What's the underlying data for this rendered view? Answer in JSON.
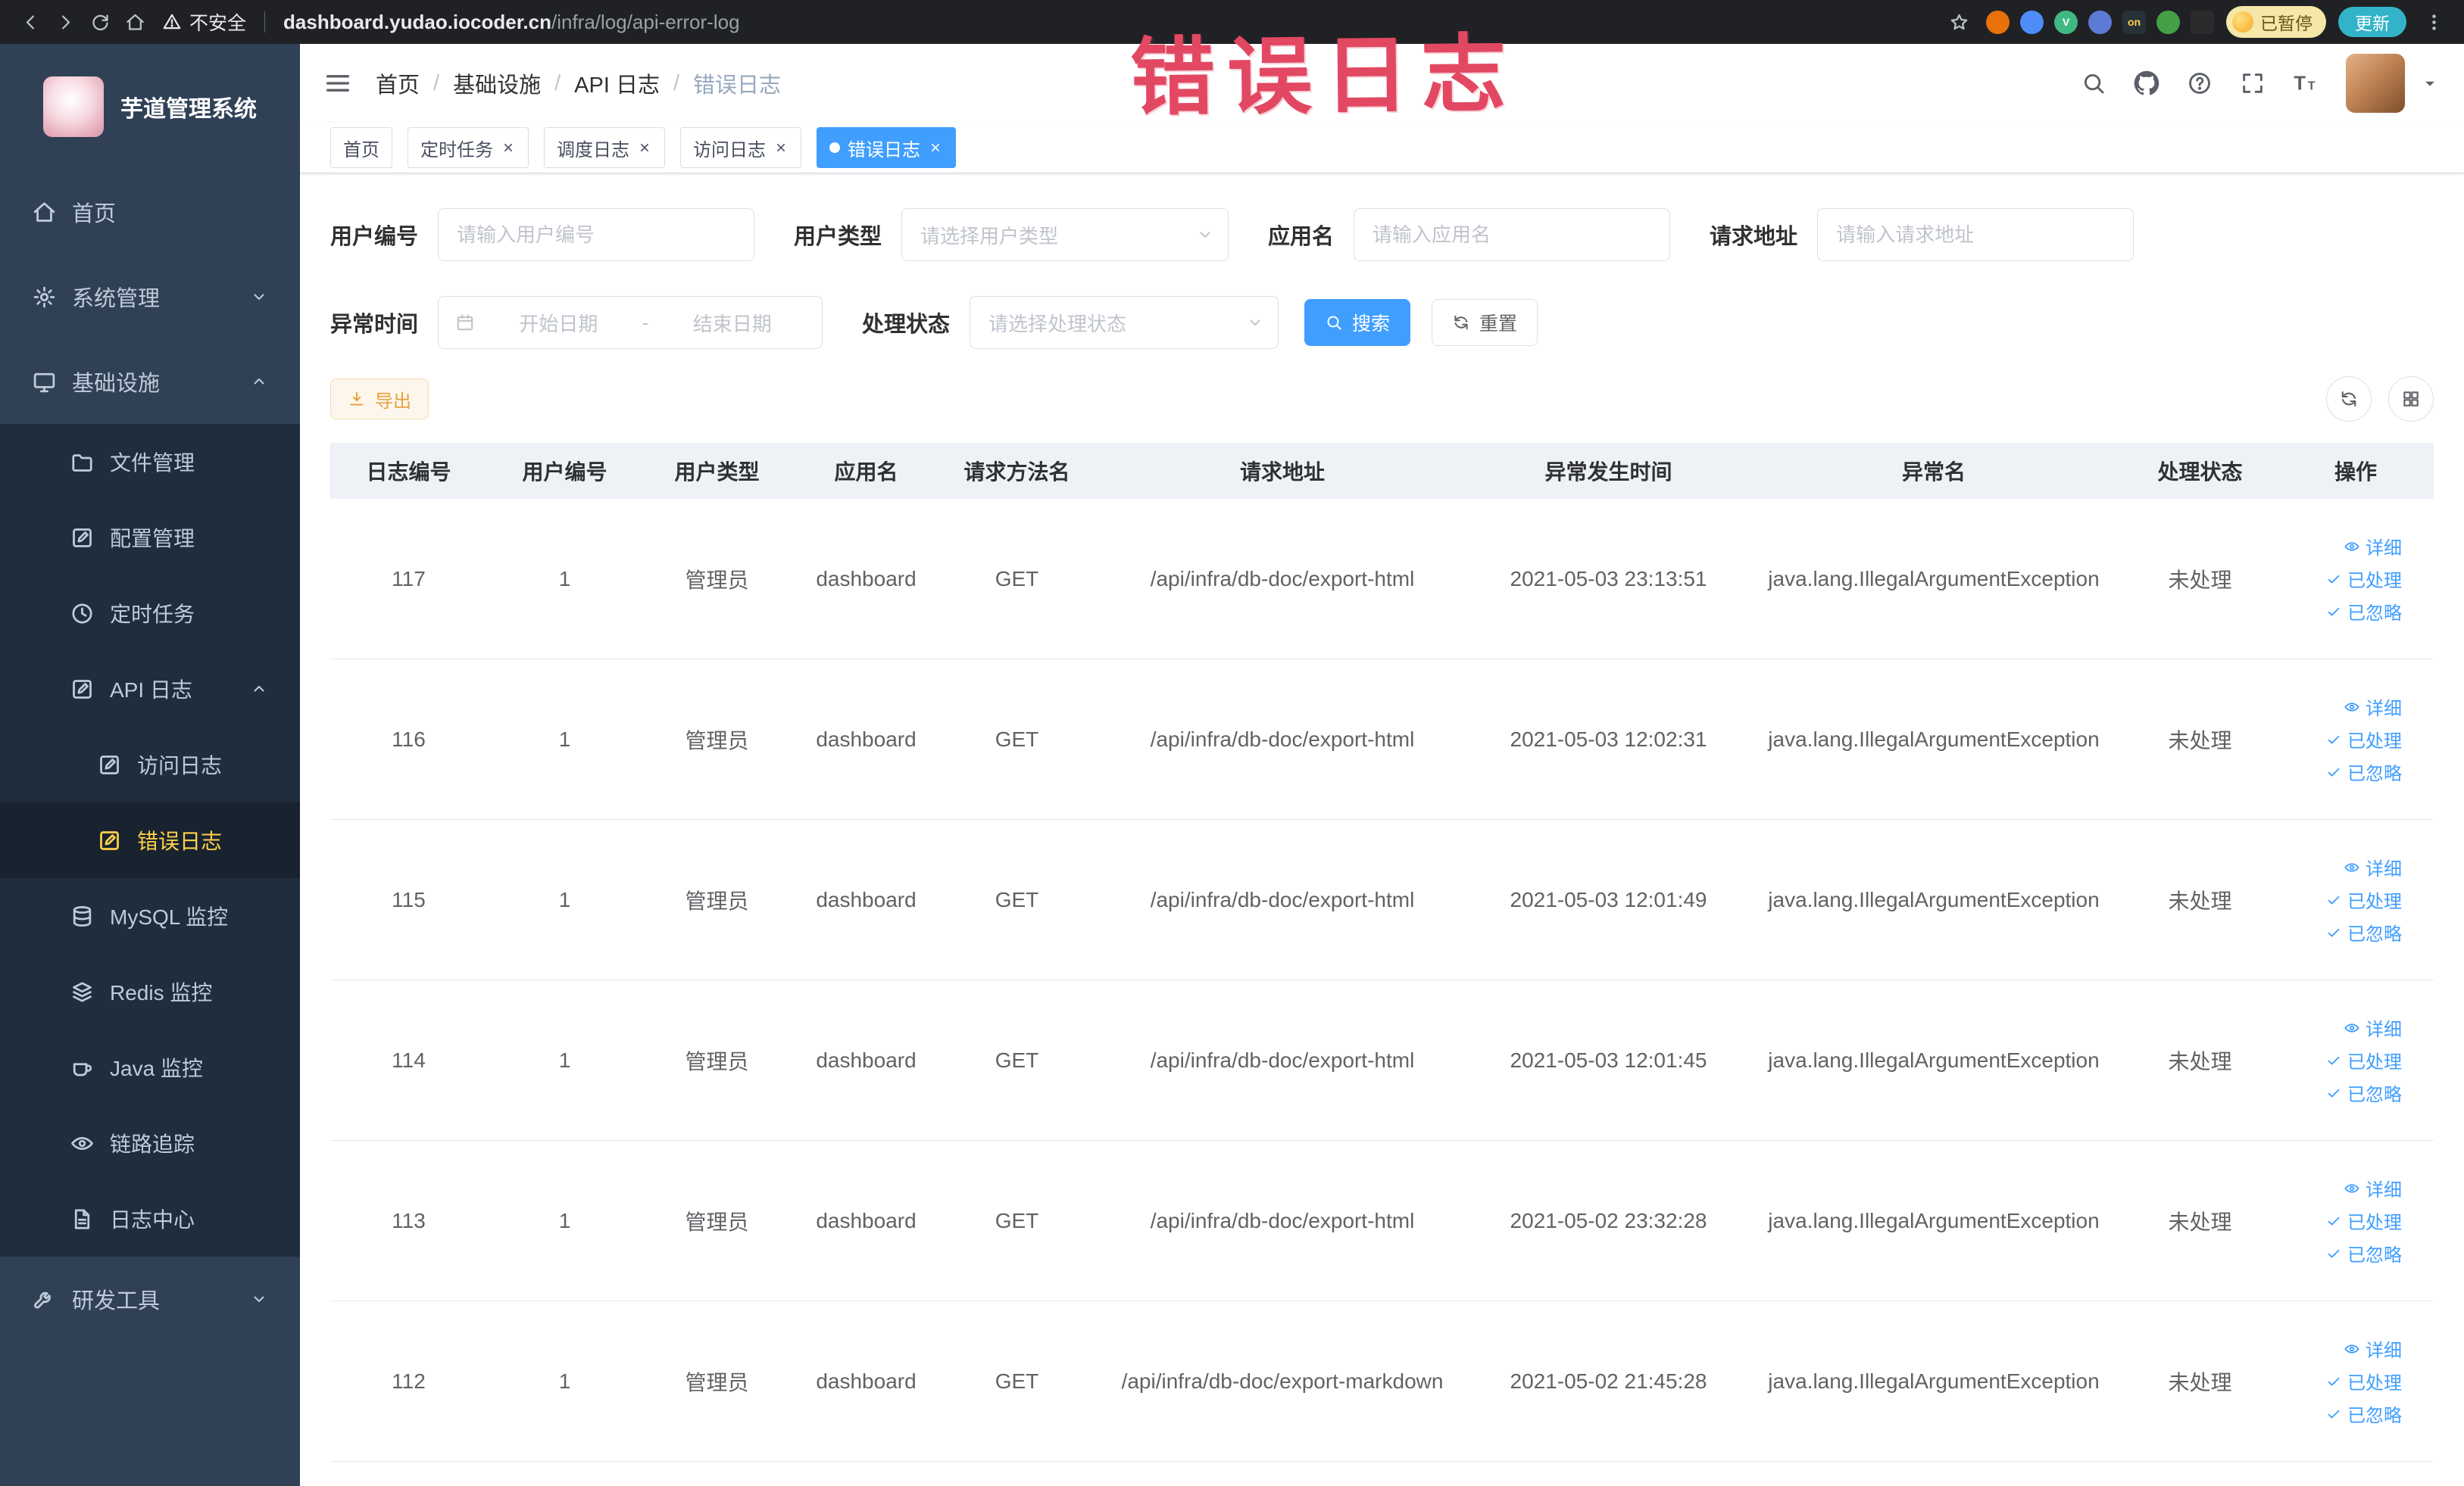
{
  "colors": {
    "primary": "#409eff",
    "menu-active": "#ffd04b",
    "sidebar-bg": "#304156",
    "submenu-bg": "#1f2d3d",
    "menu-text": "#bfcbd9",
    "warning": "#e6a23c",
    "warning-bg": "#fdf6ec",
    "warning-border": "#f5dab1",
    "annotation": "#e24862",
    "chrome-bg": "#202124",
    "update-pill": "#33b3c8",
    "paused-bg": "#f5e7a8"
  },
  "browser": {
    "security_label": "不安全",
    "url_host": "dashboard.yudao.iocoder.cn",
    "url_path": "/infra/log/api-error-log",
    "paused_badge": "已暂停",
    "update_button": "更新",
    "extensions": [
      {
        "name": "extension-orange-icon",
        "color": "#e8710a",
        "text": ""
      },
      {
        "name": "extension-blue-icon",
        "color": "#4e8cf9",
        "text": ""
      },
      {
        "name": "vue-devtools-icon",
        "color": "#41b883",
        "text": "V"
      },
      {
        "name": "extension-grid-icon",
        "color": "#5b7bd5",
        "text": ""
      },
      {
        "name": "proxy-switch-icon",
        "color": "#263238",
        "text": "on"
      },
      {
        "name": "extension-green-icon",
        "color": "#43a047",
        "text": ""
      },
      {
        "name": "tampermonkey-icon",
        "color": "#2b2b2b",
        "text": ""
      }
    ]
  },
  "annotation": {
    "text": "错误日志"
  },
  "sidebar": {
    "logo_title": "芋道管理系统",
    "items": [
      {
        "id": "home",
        "label": "首页",
        "icon": "home",
        "level": 0
      },
      {
        "id": "system",
        "label": "系统管理",
        "icon": "gear",
        "level": 0,
        "arrow": "down"
      },
      {
        "id": "infra",
        "label": "基础设施",
        "icon": "monitor",
        "level": 0,
        "arrow": "up"
      },
      {
        "id": "file",
        "label": "文件管理",
        "icon": "folder",
        "level": 1
      },
      {
        "id": "config",
        "label": "配置管理",
        "icon": "pencil-square",
        "level": 1
      },
      {
        "id": "job",
        "label": "定时任务",
        "icon": "clock",
        "level": 1
      },
      {
        "id": "api-log",
        "label": "API 日志",
        "icon": "pencil-square",
        "level": 1,
        "arrow": "up"
      },
      {
        "id": "access-log",
        "label": "访问日志",
        "icon": "pencil-square",
        "level": 2
      },
      {
        "id": "error-log",
        "label": "错误日志",
        "icon": "pencil-square",
        "level": 2,
        "active": true
      },
      {
        "id": "mysql",
        "label": "MySQL 监控",
        "icon": "database",
        "level": 1
      },
      {
        "id": "redis",
        "label": "Redis 监控",
        "icon": "layers",
        "level": 1
      },
      {
        "id": "java",
        "label": "Java 监控",
        "icon": "coffee",
        "level": 1
      },
      {
        "id": "trace",
        "label": "链路追踪",
        "icon": "eye",
        "level": 1
      },
      {
        "id": "log-center",
        "label": "日志中心",
        "icon": "doc",
        "level": 1
      },
      {
        "id": "dev-tools",
        "label": "研发工具",
        "icon": "wrench",
        "level": 0,
        "arrow": "down"
      }
    ]
  },
  "header": {
    "breadcrumb": [
      "首页",
      "基础设施",
      "API 日志",
      "错误日志"
    ],
    "actions": [
      "search",
      "github",
      "question",
      "fullscreen",
      "font-size"
    ]
  },
  "tabs": [
    {
      "label": "首页",
      "closable": false,
      "active": false
    },
    {
      "label": "定时任务",
      "closable": true,
      "active": false
    },
    {
      "label": "调度日志",
      "closable": true,
      "active": false
    },
    {
      "label": "访问日志",
      "closable": true,
      "active": false
    },
    {
      "label": "错误日志",
      "closable": true,
      "active": true
    }
  ],
  "filters": {
    "user_id": {
      "label": "用户编号",
      "placeholder": "请输入用户编号"
    },
    "user_type": {
      "label": "用户类型",
      "placeholder": "请选择用户类型"
    },
    "app_name": {
      "label": "应用名",
      "placeholder": "请输入应用名"
    },
    "request_url": {
      "label": "请求地址",
      "placeholder": "请输入请求地址"
    },
    "exception_time": {
      "label": "异常时间",
      "start_placeholder": "开始日期",
      "separator": "-",
      "end_placeholder": "结束日期"
    },
    "process_status": {
      "label": "处理状态",
      "placeholder": "请选择处理状态"
    },
    "search_label": "搜索",
    "reset_label": "重置"
  },
  "toolbar": {
    "export_label": "导出"
  },
  "table": {
    "columns": [
      {
        "key": "log_id",
        "label": "日志编号"
      },
      {
        "key": "user_id",
        "label": "用户编号"
      },
      {
        "key": "user_type",
        "label": "用户类型"
      },
      {
        "key": "app_name",
        "label": "应用名"
      },
      {
        "key": "method",
        "label": "请求方法名"
      },
      {
        "key": "url",
        "label": "请求地址"
      },
      {
        "key": "time",
        "label": "异常发生时间"
      },
      {
        "key": "exception",
        "label": "异常名"
      },
      {
        "key": "status",
        "label": "处理状态"
      },
      {
        "key": "actions",
        "label": "操作"
      }
    ],
    "actions": [
      {
        "label": "详细",
        "icon": "eye"
      },
      {
        "label": "已处理",
        "icon": "check"
      },
      {
        "label": "已忽略",
        "icon": "check"
      }
    ],
    "rows": [
      {
        "log_id": "117",
        "user_id": "1",
        "user_type": "管理员",
        "app_name": "dashboard",
        "method": "GET",
        "url": "/api/infra/db-doc/export-html",
        "time": "2021-05-03 23:13:51",
        "exception": "java.lang.IllegalArgumentException",
        "status": "未处理"
      },
      {
        "log_id": "116",
        "user_id": "1",
        "user_type": "管理员",
        "app_name": "dashboard",
        "method": "GET",
        "url": "/api/infra/db-doc/export-html",
        "time": "2021-05-03 12:02:31",
        "exception": "java.lang.IllegalArgumentException",
        "status": "未处理"
      },
      {
        "log_id": "115",
        "user_id": "1",
        "user_type": "管理员",
        "app_name": "dashboard",
        "method": "GET",
        "url": "/api/infra/db-doc/export-html",
        "time": "2021-05-03 12:01:49",
        "exception": "java.lang.IllegalArgumentException",
        "status": "未处理"
      },
      {
        "log_id": "114",
        "user_id": "1",
        "user_type": "管理员",
        "app_name": "dashboard",
        "method": "GET",
        "url": "/api/infra/db-doc/export-html",
        "time": "2021-05-03 12:01:45",
        "exception": "java.lang.IllegalArgumentException",
        "status": "未处理"
      },
      {
        "log_id": "113",
        "user_id": "1",
        "user_type": "管理员",
        "app_name": "dashboard",
        "method": "GET",
        "url": "/api/infra/db-doc/export-html",
        "time": "2021-05-02 23:32:28",
        "exception": "java.lang.IllegalArgumentException",
        "status": "未处理"
      },
      {
        "log_id": "112",
        "user_id": "1",
        "user_type": "管理员",
        "app_name": "dashboard",
        "method": "GET",
        "url": "/api/infra/db-doc/export-markdown",
        "time": "2021-05-02 21:45:28",
        "exception": "java.lang.IllegalArgumentException",
        "status": "未处理"
      }
    ]
  }
}
